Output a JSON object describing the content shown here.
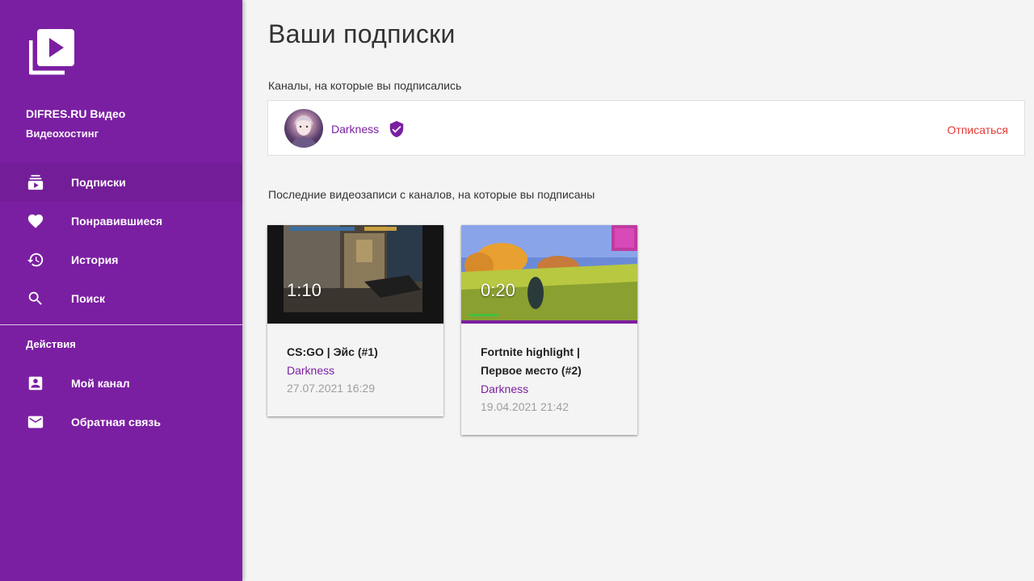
{
  "app": {
    "title": "DIFRES.RU Видео",
    "subtitle": "Видеохостинг",
    "logo_icon": "video-library-icon"
  },
  "sidebar": {
    "items": [
      {
        "label": "Подписки",
        "icon": "subscriptions-icon",
        "active": true
      },
      {
        "label": "Понравившиеся",
        "icon": "heart-icon",
        "active": false
      },
      {
        "label": "История",
        "icon": "history-icon",
        "active": false
      },
      {
        "label": "Поиск",
        "icon": "search-icon",
        "active": false
      }
    ],
    "actions_title": "Действия",
    "actions": [
      {
        "label": "Мой канал",
        "icon": "account-box-icon"
      },
      {
        "label": "Обратная связь",
        "icon": "mail-icon"
      }
    ]
  },
  "main": {
    "title": "Ваши подписки",
    "subscriptions_label": "Каналы, на которые вы подписались",
    "channel": {
      "name": "Darkness",
      "verified_icon": "verified-shield-icon",
      "unsubscribe_label": "Отписаться"
    },
    "videos_label": "Последние видеозаписи с каналов, на которые вы подписаны",
    "videos": [
      {
        "title": "CS:GO | Эйс (#1)",
        "channel": "Darkness",
        "date": "27.07.2021 16:29",
        "duration": "1:10"
      },
      {
        "title": "Fortnite highlight | Первое место (#2)",
        "channel": "Darkness",
        "date": "19.04.2021 21:42",
        "duration": "0:20"
      }
    ]
  },
  "colors": {
    "sidebar": "#7b1fa2",
    "accent": "#7b1fa2",
    "danger": "#e53935"
  }
}
